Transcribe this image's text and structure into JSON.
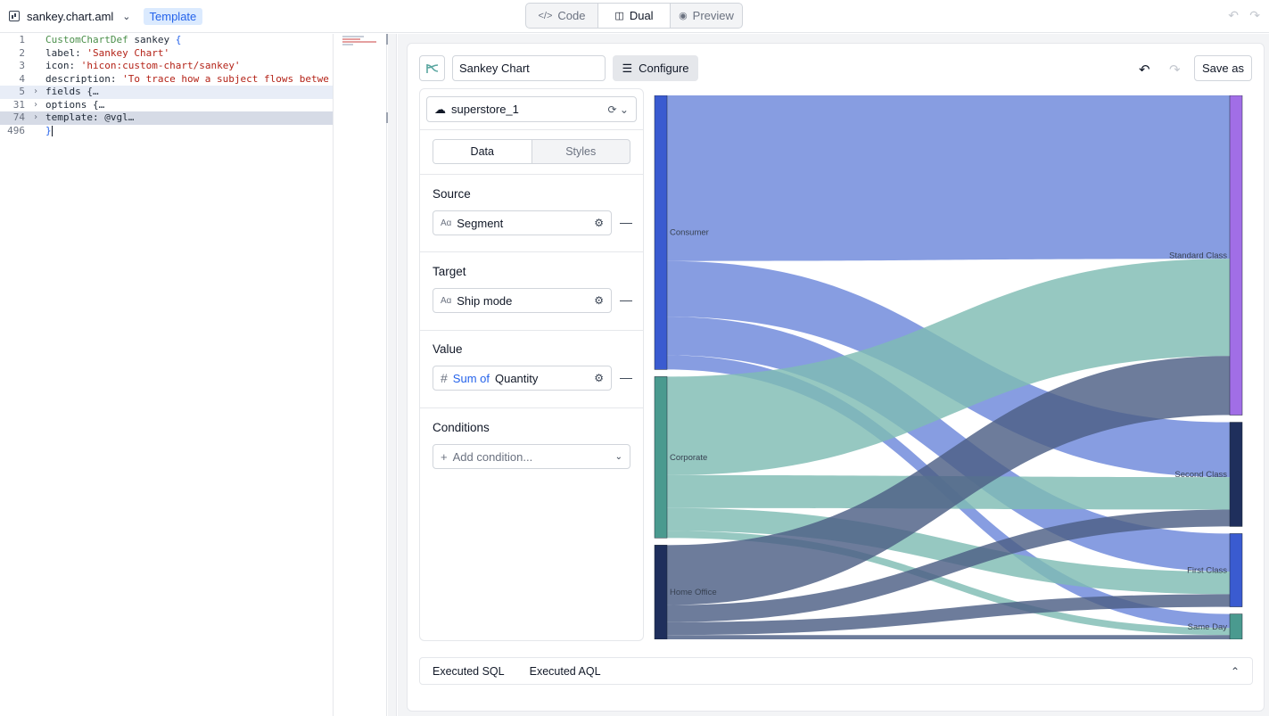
{
  "topbar": {
    "file_name": "sankey.chart.aml",
    "template_badge": "Template",
    "modes": [
      {
        "label": "Code",
        "icon": "code-icon",
        "active": false
      },
      {
        "label": "Dual",
        "icon": "split-icon",
        "active": true
      },
      {
        "label": "Preview",
        "icon": "eye-icon",
        "active": false
      }
    ]
  },
  "editor": {
    "lines": [
      {
        "num": "1",
        "parts": [
          {
            "t": "CustomChartDef",
            "c": "kw"
          },
          {
            "t": " sankey ",
            "c": "pl"
          },
          {
            "t": "{",
            "c": "brace"
          }
        ],
        "fold": false,
        "hl": ""
      },
      {
        "num": "2",
        "parts": [
          {
            "t": "  label: ",
            "c": "pl"
          },
          {
            "t": "'Sankey Chart'",
            "c": "str"
          }
        ],
        "fold": false,
        "hl": ""
      },
      {
        "num": "3",
        "parts": [
          {
            "t": "  icon: ",
            "c": "pl"
          },
          {
            "t": "'hicon:custom-chart/sankey'",
            "c": "str"
          }
        ],
        "fold": false,
        "hl": ""
      },
      {
        "num": "4",
        "parts": [
          {
            "t": "  description: ",
            "c": "pl"
          },
          {
            "t": "'To trace how a subject flows betwe",
            "c": "str"
          }
        ],
        "fold": false,
        "hl": ""
      },
      {
        "num": "5",
        "parts": [
          {
            "t": "  fields {",
            "c": "pl"
          },
          {
            "t": "…",
            "c": "pl"
          }
        ],
        "fold": true,
        "hl": "hl"
      },
      {
        "num": "31",
        "parts": [
          {
            "t": "  options {",
            "c": "pl"
          },
          {
            "t": "…",
            "c": "pl"
          }
        ],
        "fold": true,
        "hl": ""
      },
      {
        "num": "74",
        "parts": [
          {
            "t": "  template: ",
            "c": "pl"
          },
          {
            "t": "@vgl",
            "c": "pl"
          },
          {
            "t": "…",
            "c": "pl"
          }
        ],
        "fold": true,
        "hl": "hl2"
      },
      {
        "num": "496",
        "parts": [
          {
            "t": "}",
            "c": "brace"
          }
        ],
        "fold": false,
        "hl": "",
        "cursor": true
      }
    ]
  },
  "preview": {
    "chart_name": "Sankey Chart",
    "configure_label": "Configure",
    "save_as_label": "Save as",
    "dataset": "superstore_1",
    "tabs": [
      {
        "label": "Data",
        "active": true
      },
      {
        "label": "Styles",
        "active": false
      }
    ],
    "source": {
      "title": "Source",
      "field": "Segment",
      "type_icon": "text-type-icon"
    },
    "target": {
      "title": "Target",
      "field": "Ship mode",
      "type_icon": "text-type-icon"
    },
    "value": {
      "title": "Value",
      "agg": "Sum of",
      "field": "Quantity",
      "type_icon": "number-type-icon"
    },
    "conditions": {
      "title": "Conditions",
      "placeholder": "Add condition..."
    },
    "bottom_tabs": [
      "Executed SQL",
      "Executed AQL"
    ]
  },
  "chart_data": {
    "type": "sankey",
    "unit": "Sum of Quantity",
    "sources": [
      {
        "name": "Consumer",
        "color": "#3a5bd0"
      },
      {
        "name": "Corporate",
        "color": "#4a9a8f"
      },
      {
        "name": "Home Office",
        "color": "#1f2f5c"
      }
    ],
    "targets": [
      {
        "name": "Standard Class",
        "color": "#a16ee6"
      },
      {
        "name": "Second Class",
        "color": "#1f2f5c"
      },
      {
        "name": "First Class",
        "color": "#3a5bd0"
      },
      {
        "name": "Same Day",
        "color": "#4a9a8f"
      }
    ],
    "link_colors": {
      "Consumer": "#6d88da",
      "Corporate": "#7fbcb3",
      "Home Office": "#4d5f85"
    },
    "links": [
      {
        "source": "Consumer",
        "target": "Standard Class",
        "value": 11600
      },
      {
        "source": "Consumer",
        "target": "Second Class",
        "value": 3900
      },
      {
        "source": "Consumer",
        "target": "First Class",
        "value": 2700
      },
      {
        "source": "Consumer",
        "target": "Same Day",
        "value": 1000
      },
      {
        "source": "Corporate",
        "target": "Standard Class",
        "value": 6900
      },
      {
        "source": "Corporate",
        "target": "Second Class",
        "value": 2300
      },
      {
        "source": "Corporate",
        "target": "First Class",
        "value": 1600
      },
      {
        "source": "Corporate",
        "target": "Same Day",
        "value": 500
      },
      {
        "source": "Home Office",
        "target": "Standard Class",
        "value": 4200
      },
      {
        "source": "Home Office",
        "target": "Second Class",
        "value": 1200
      },
      {
        "source": "Home Office",
        "target": "First Class",
        "value": 900
      },
      {
        "source": "Home Office",
        "target": "Same Day",
        "value": 300
      }
    ]
  }
}
